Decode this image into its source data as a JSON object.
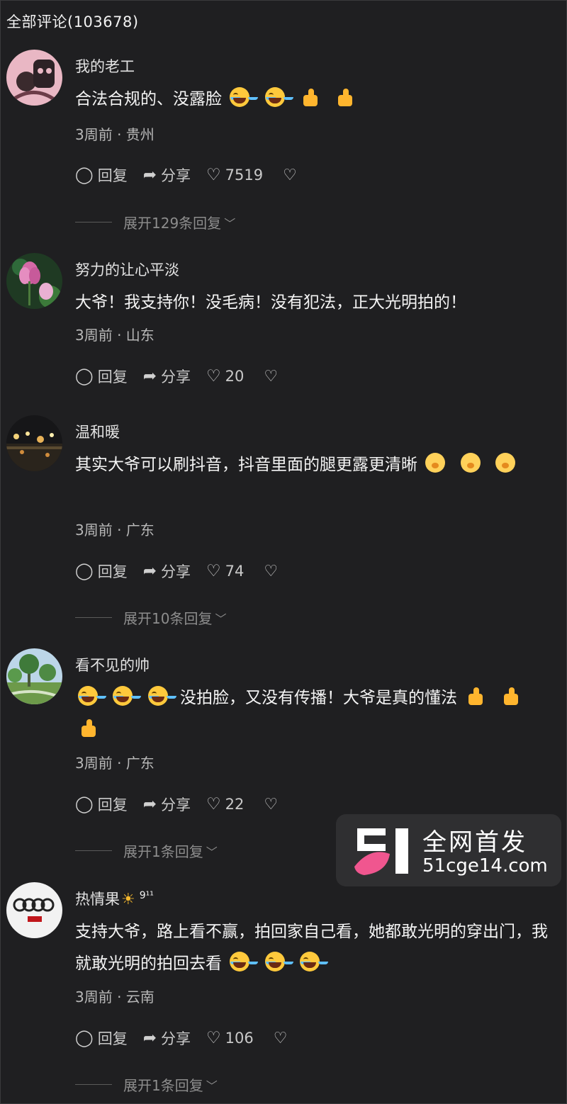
{
  "header": {
    "title": "全部评论(103678)"
  },
  "actions": {
    "reply": "回复",
    "share": "分享"
  },
  "comments": [
    {
      "username": "我的老工",
      "text": "合法合规的、没露脸",
      "time_location": "3周前 · 贵州",
      "likes": "7519",
      "expand": "展开129条回复"
    },
    {
      "username": "努力的让心平淡",
      "text": "大爷！我支持你！没毛病！没有犯法，正大光明拍的！",
      "time_location": "3周前 · 山东",
      "likes": "20"
    },
    {
      "username": "温和暖",
      "text": "其实大爷可以刷抖音，抖音里面的腿更露更清晰",
      "time_location": "3周前 · 广东",
      "likes": "74",
      "expand": "展开10条回复"
    },
    {
      "username": "看不见的帅",
      "text": "没拍脸，又没有传播！大爷是真的懂法",
      "time_location": "3周前 · 广东",
      "likes": "22",
      "expand": "展开1条回复"
    },
    {
      "username": "热情果",
      "user_badge": "9¹¹",
      "text": "支持大爷，路上看不赢，拍回家自己看，她都敢光明的穿出门，我就敢光明的拍回去看",
      "time_location": "3周前 · 云南",
      "likes": "106",
      "expand": "展开1条回复"
    }
  ],
  "watermark": {
    "title": "全网首发",
    "url": "51cge14.com"
  },
  "icons": {
    "reply": "comment-bubble-icon",
    "share": "share-arrow-icon",
    "like": "heart-icon",
    "dislike": "broken-heart-icon",
    "expand": "chevron-down-icon"
  }
}
